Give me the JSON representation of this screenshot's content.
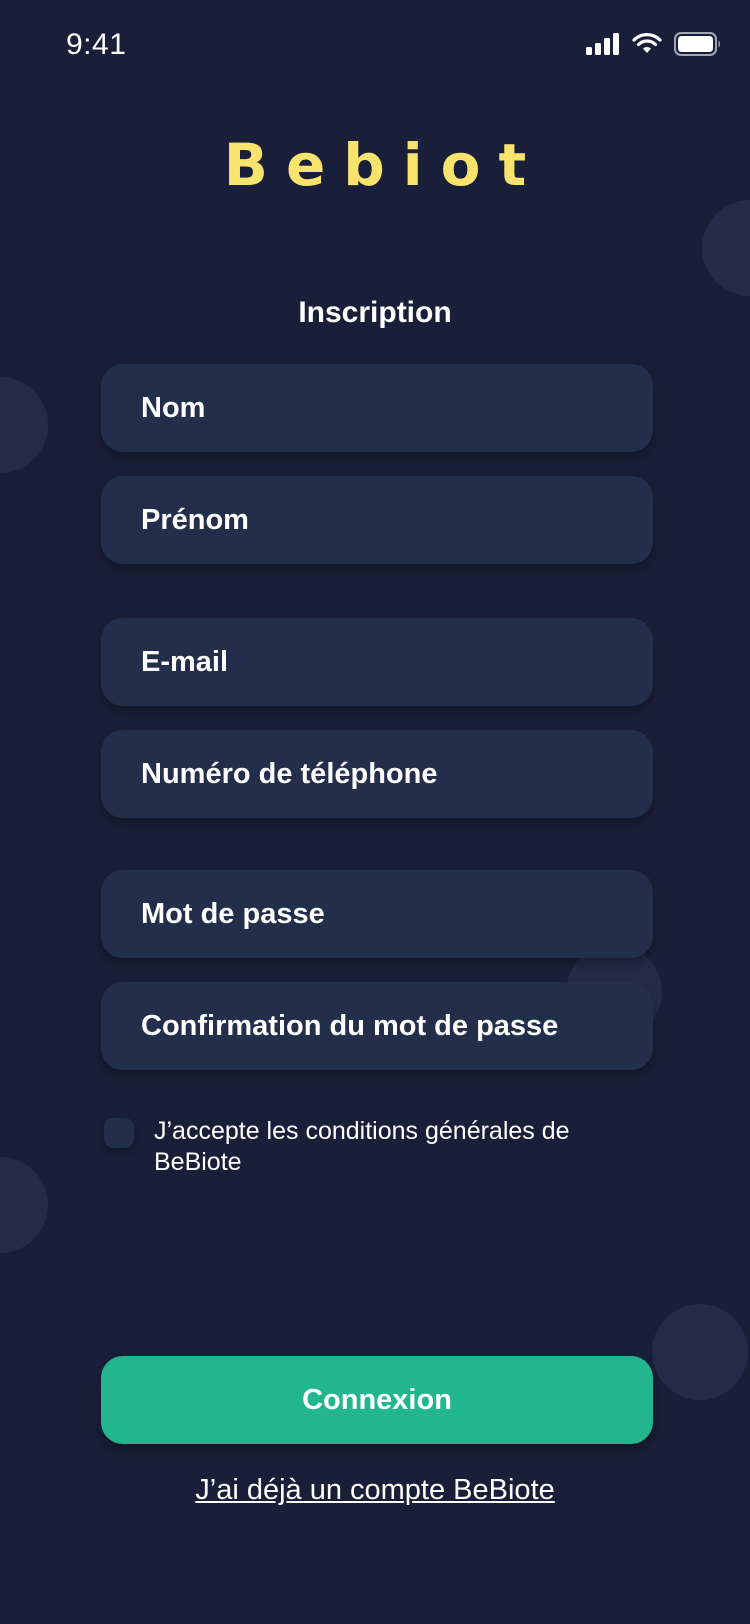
{
  "status_bar": {
    "time": "9:41"
  },
  "app": {
    "logo_text": "Bebiot",
    "logo_color": "#f8e36d"
  },
  "form": {
    "heading": "Inscription",
    "fields": [
      {
        "placeholder": "Nom"
      },
      {
        "placeholder": "Prénom"
      },
      {
        "placeholder": "E-mail"
      },
      {
        "placeholder": "Numéro de téléphone"
      },
      {
        "placeholder": "Mot de passe"
      },
      {
        "placeholder": "Confirmation du mot de passe"
      }
    ],
    "terms_label": "J’accepte les conditions générales de BeBiote",
    "terms_checked": false,
    "submit_label": "Connexion",
    "login_link": "J’ai déjà un compte BeBiote"
  },
  "colors": {
    "background": "#191f38",
    "field": "#232e4a",
    "accent": "#22b68e"
  },
  "icons": [
    "cellular-signal-icon",
    "wifi-icon",
    "battery-icon"
  ]
}
